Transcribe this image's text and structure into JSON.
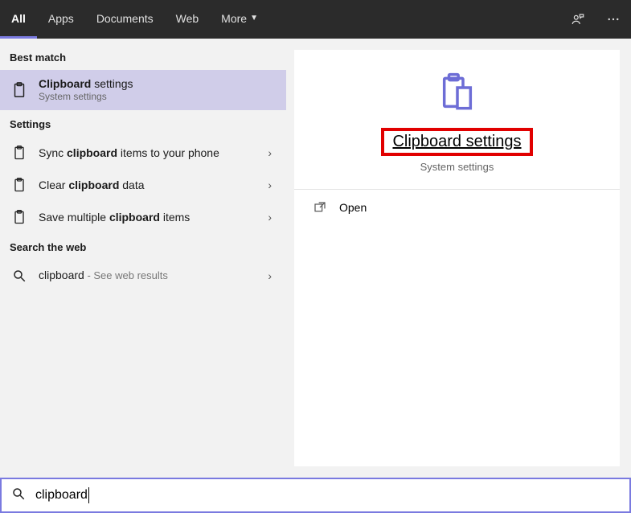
{
  "topbar": {
    "tabs": [
      "All",
      "Apps",
      "Documents",
      "Web",
      "More"
    ],
    "active_index": 0
  },
  "left": {
    "best_match_header": "Best match",
    "best_match": {
      "title_prefix": "Clipboard",
      "title_suffix": " settings",
      "subtitle": "System settings"
    },
    "settings_header": "Settings",
    "settings": [
      {
        "pre": "Sync ",
        "bold": "clipboard",
        "post": " items to your phone"
      },
      {
        "pre": "Clear ",
        "bold": "clipboard",
        "post": " data"
      },
      {
        "pre": "Save multiple ",
        "bold": "clipboard",
        "post": " items"
      }
    ],
    "web_header": "Search the web",
    "web": {
      "term": "clipboard",
      "suffix": " - See web results"
    }
  },
  "detail": {
    "title": "Clipboard settings",
    "subtitle": "System settings",
    "open_label": "Open"
  },
  "search": {
    "value": "clipboard"
  }
}
